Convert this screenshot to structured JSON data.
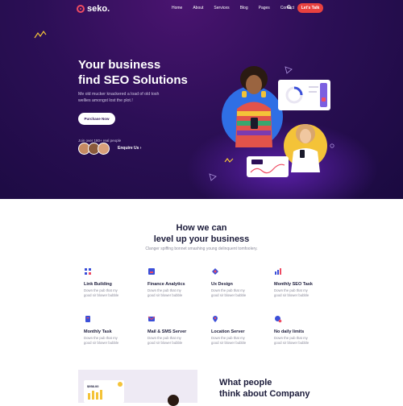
{
  "nav": {
    "logo_text": "seko.",
    "items": [
      "Home",
      "About",
      "Services",
      "Blog",
      "Pages",
      "Contact"
    ],
    "cta_label": "Let's Talk"
  },
  "hero": {
    "title_line1": "Your business",
    "title_line2": "find SEO Solutions",
    "subtitle_line1": "Me old mucker knackered a load of old tosh",
    "subtitle_line2": "wellies amongst lost the plot.!",
    "purchase_label": "Purchase Now",
    "join_text": "Join over 180+ real people",
    "enquire_label": "Enquire Us"
  },
  "services": {
    "title_line1": "How we can",
    "title_line2": "level up your business",
    "subtitle": "Clanger spiffing bonnet smashing young delinquent tomfoolery.",
    "items": [
      {
        "name": "Link Building",
        "desc": "Down the pub that my good sir blower bubble",
        "icon": "link-icon",
        "color": "#3b4fd8"
      },
      {
        "name": "Finance Analytics",
        "desc": "Down the pub that my good sir blower bubble",
        "icon": "analytics-icon",
        "color": "#3b4fd8"
      },
      {
        "name": "Ux Design",
        "desc": "Down the pub that my good sir blower bubble",
        "icon": "design-icon",
        "color": "#3b4fd8"
      },
      {
        "name": "Monthly SEO Task",
        "desc": "Down the pub that my good sir blower bubble",
        "icon": "chart-icon",
        "color": "#3b4fd8"
      },
      {
        "name": "Monthly Task",
        "desc": "Down the pub that my good sir blower bubble",
        "icon": "task-icon",
        "color": "#3b4fd8"
      },
      {
        "name": "Mail & SMS Server",
        "desc": "Down the pub that my good sir blower bubble",
        "icon": "mail-icon",
        "color": "#3b4fd8"
      },
      {
        "name": "Location Server",
        "desc": "Down the pub that my good sir blower bubble",
        "icon": "location-icon",
        "color": "#3b4fd8"
      },
      {
        "name": "No daily limits",
        "desc": "Down the pub that my good sir blower bubble",
        "icon": "limits-icon",
        "color": "#3b4fd8"
      }
    ]
  },
  "testimonials": {
    "title_line1": "What people",
    "title_line2": "think about Company",
    "panel_value": "$958.00"
  },
  "colors": {
    "accent": "#e9413f",
    "brand": "#2c0f56",
    "icon_blue": "#3b4fd8",
    "icon_red": "#ef4b62"
  }
}
